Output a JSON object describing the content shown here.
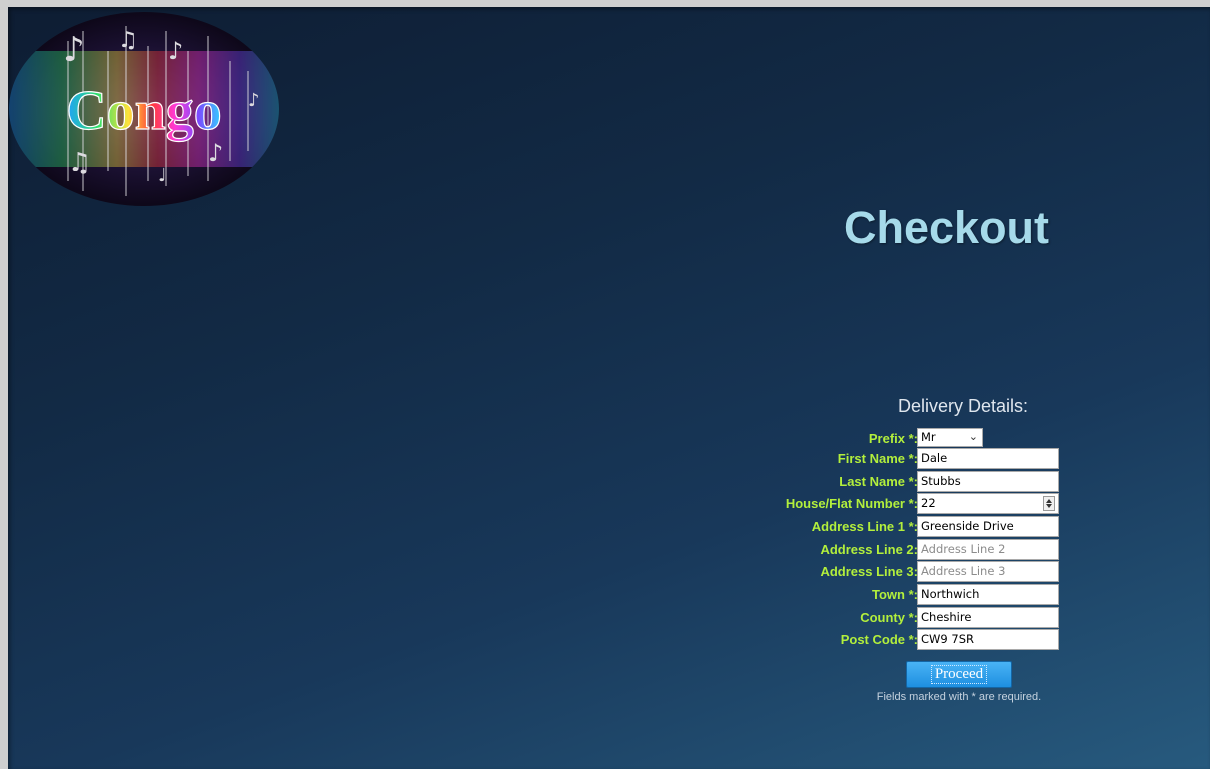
{
  "logo": {
    "text": "Congo"
  },
  "page": {
    "title": "Checkout"
  },
  "form": {
    "heading": "Delivery Details:",
    "prefix": {
      "label": "Prefix *:",
      "value": "Mr"
    },
    "first_name": {
      "label": "First Name *:",
      "value": "Dale"
    },
    "last_name": {
      "label": "Last Name *:",
      "value": "Stubbs"
    },
    "house_number": {
      "label": "House/Flat Number *:",
      "value": "22"
    },
    "address1": {
      "label": "Address Line 1 *:",
      "value": "Greenside Drive"
    },
    "address2": {
      "label": "Address Line 2:",
      "placeholder": "Address Line 2"
    },
    "address3": {
      "label": "Address Line 3:",
      "placeholder": "Address Line 3"
    },
    "town": {
      "label": "Town *:",
      "value": "Northwich"
    },
    "county": {
      "label": "County *:",
      "value": "Cheshire"
    },
    "postcode": {
      "label": "Post Code *:",
      "value": "CW9 7SR"
    },
    "proceed_label": "Proceed",
    "required_note": "Fields marked with * are required."
  },
  "colors": {
    "label": "#b3ef3c",
    "title": "#a6daea",
    "button": "#2b9cea"
  }
}
